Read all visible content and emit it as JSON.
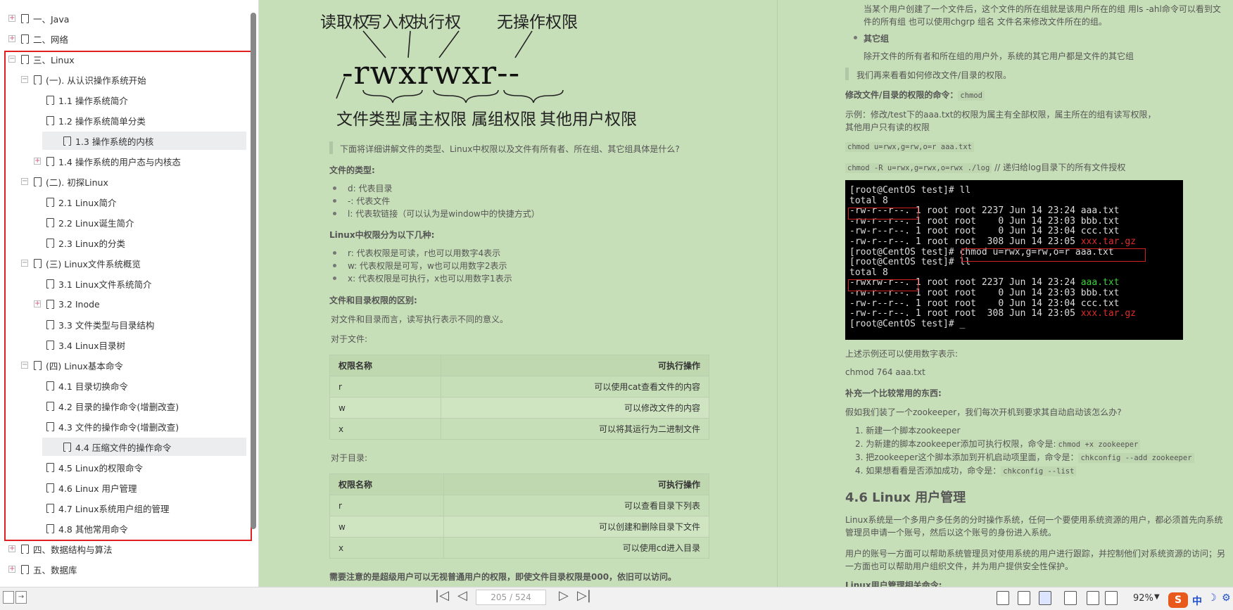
{
  "toc": [
    {
      "label": "一、Java",
      "level": 0,
      "expander": "plus"
    },
    {
      "label": "二、网络",
      "level": 0,
      "expander": "plus"
    },
    {
      "label": "三、Linux",
      "level": 0,
      "expander": "minus"
    },
    {
      "label": "(一). 从认识操作系统开始",
      "level": 1,
      "expander": "minus"
    },
    {
      "label": "1.1 操作系统简介",
      "level": 2,
      "expander": ""
    },
    {
      "label": "1.2 操作系统简单分类",
      "level": 2,
      "expander": ""
    },
    {
      "label": "1.3 操作系统的内核",
      "level": 2,
      "expander": "",
      "selected": true
    },
    {
      "label": "1.4 操作系统的用户态与内核态",
      "level": 2,
      "expander": "plus"
    },
    {
      "label": "(二). 初探Linux",
      "level": 1,
      "expander": "minus"
    },
    {
      "label": "2.1 Linux简介",
      "level": 2,
      "expander": ""
    },
    {
      "label": "2.2 Linux诞生简介",
      "level": 2,
      "expander": ""
    },
    {
      "label": "2.3 Linux的分类",
      "level": 2,
      "expander": ""
    },
    {
      "label": "(三) Linux文件系统概览",
      "level": 1,
      "expander": "minus"
    },
    {
      "label": "3.1 Linux文件系统简介",
      "level": 2,
      "expander": ""
    },
    {
      "label": "3.2 Inode",
      "level": 2,
      "expander": "plus"
    },
    {
      "label": "3.3 文件类型与目录结构",
      "level": 2,
      "expander": ""
    },
    {
      "label": "3.4 Linux目录树",
      "level": 2,
      "expander": ""
    },
    {
      "label": "(四) Linux基本命令",
      "level": 1,
      "expander": "minus"
    },
    {
      "label": "4.1 目录切换命令",
      "level": 2,
      "expander": ""
    },
    {
      "label": "4.2 目录的操作命令(增删改查)",
      "level": 2,
      "expander": ""
    },
    {
      "label": "4.3 文件的操作命令(增删改查)",
      "level": 2,
      "expander": ""
    },
    {
      "label": "4.4 压缩文件的操作命令",
      "level": 2,
      "expander": "",
      "selected": true
    },
    {
      "label": "4.5 Linux的权限命令",
      "level": 2,
      "expander": ""
    },
    {
      "label": "4.6 Linux 用户管理",
      "level": 2,
      "expander": ""
    },
    {
      "label": "4.7 Linux系统用户组的管理",
      "level": 2,
      "expander": ""
    },
    {
      "label": "4.8 其他常用命令",
      "level": 2,
      "expander": ""
    },
    {
      "label": "四、数据结构与算法",
      "level": 0,
      "expander": "plus"
    },
    {
      "label": "五、数据库",
      "level": 0,
      "expander": "plus"
    }
  ],
  "diagram": {
    "top": [
      "读取权",
      "写入权",
      "执行权",
      "无操作权限"
    ],
    "perm": "-rwxrwxr--",
    "bottom": [
      "文件类型",
      "属主权限",
      "属组权限",
      "其他用户权限"
    ]
  },
  "col1": {
    "intro": "下面将详细讲解文件的类型、Linux中权限以及文件有所有者、所在组、其它组具体是什么?",
    "types_h": "文件的类型:",
    "types": [
      "d: 代表目录",
      "-: 代表文件",
      "l: 代表软链接（可以认为是window中的快捷方式）"
    ],
    "perms_h": "Linux中权限分为以下几种:",
    "perms": [
      "r: 代表权限是可读，r也可以用数字4表示",
      "w: 代表权限是可写，w也可以用数字2表示",
      "x: 代表权限是可执行，x也可以用数字1表示"
    ],
    "diff_h": "文件和目录权限的区别:",
    "diff_p": "对文件和目录而言，读写执行表示不同的意义。",
    "file_p": "对于文件:",
    "table_file": {
      "head": [
        "权限名称",
        "可执行操作"
      ],
      "rows": [
        [
          "r",
          "可以使用cat查看文件的内容"
        ],
        [
          "w",
          "可以修改文件的内容"
        ],
        [
          "x",
          "可以将其运行为二进制文件"
        ]
      ]
    },
    "dir_p": "对于目录:",
    "table_dir": {
      "head": [
        "权限名称",
        "可执行操作"
      ],
      "rows": [
        [
          "r",
          "可以查看目录下列表"
        ],
        [
          "w",
          "可以创建和删除目录下文件"
        ],
        [
          "x",
          "可以使用cd进入目录"
        ]
      ]
    },
    "note": "需要注意的是超级用户可以无视普通用户的权限，即使文件目录权限是000，依旧可以访问。"
  },
  "col2": {
    "p1a": "当某个用户创建了一个文件后，这个文件的所在组就是该用户所在的组 用ls -ahl命令可以看到文",
    "p1b": "件的所有组 也可以使用chgrp  组名  文件名来修改文件所在的组。",
    "other_h": "其它组",
    "other_p": "除开文件的所有者和所在组的用户外，系统的其它用户都是文件的其它组",
    "bq": "我们再来看看如何修改文件/目录的权限。",
    "cmd_label": "修改文件/目录的权限的命令：",
    "cmd": "chmod",
    "ex1": "示例：修改/test下的aaa.txt的权限为属主有全部权限，属主所在的组有读写权限，",
    "ex2": "其他用户只有读的权限",
    "code1": "chmod u=rwx,g=rw,o=r aaa.txt",
    "code2": "chmod -R u=rwx,g=rwx,o=rwx ./log",
    "code2_note": "// 递归给log目录下的所有文件授权",
    "term": [
      {
        "parts": [
          {
            "t": "[root@CentOS test]# ll",
            "c": ""
          }
        ]
      },
      {
        "parts": [
          {
            "t": "total 8",
            "c": ""
          }
        ]
      },
      {
        "parts": [
          {
            "t": "-rw-r--r--. 1 root root 2237 Jun 14 23:24 aaa.txt",
            "c": ""
          }
        ]
      },
      {
        "parts": [
          {
            "t": "-rw-r--r--. 1 root root    0 Jun 14 23:03 bbb.txt",
            "c": ""
          }
        ]
      },
      {
        "parts": [
          {
            "t": "-rw-r--r--. 1 root root    0 Jun 14 23:04 ccc.txt",
            "c": ""
          }
        ]
      },
      {
        "parts": [
          {
            "t": "-rw-r--r--. 1 root root  308 Jun 14 23:05 ",
            "c": ""
          },
          {
            "t": "xxx.tar.gz",
            "c": "rd"
          }
        ]
      },
      {
        "parts": [
          {
            "t": "[root@CentOS test]# chmod u=rwx,g=rw,o=r aaa.txt",
            "c": ""
          }
        ]
      },
      {
        "parts": [
          {
            "t": "[root@CentOS test]# ll",
            "c": ""
          }
        ]
      },
      {
        "parts": [
          {
            "t": "total 8",
            "c": ""
          }
        ]
      },
      {
        "parts": [
          {
            "t": "-rwxrw-r--. 1 root root 2237 Jun 14 23:24 ",
            "c": ""
          },
          {
            "t": "aaa.txt",
            "c": "g"
          }
        ]
      },
      {
        "parts": [
          {
            "t": "-rw-r--r--. 1 root root    0 Jun 14 23:03 bbb.txt",
            "c": ""
          }
        ]
      },
      {
        "parts": [
          {
            "t": "-rw-r--r--. 1 root root    0 Jun 14 23:04 ccc.txt",
            "c": ""
          }
        ]
      },
      {
        "parts": [
          {
            "t": "-rw-r--r--. 1 root root  308 Jun 14 23:05 ",
            "c": ""
          },
          {
            "t": "xxx.tar.gz",
            "c": "rd"
          }
        ]
      },
      {
        "parts": [
          {
            "t": "[root@CentOS test]# _",
            "c": ""
          }
        ]
      }
    ],
    "num_p": "上述示例还可以使用数字表示:",
    "num_cmd": "chmod 764 aaa.txt",
    "extra_h": "补充一个比较常用的东西:",
    "extra_p": "假如我们装了一个zookeeper，我们每次开机到要求其自动启动该怎么办?",
    "steps": [
      {
        "text": "新建一个脚本zookeeper",
        "code": ""
      },
      {
        "text": "为新建的脚本zookeeper添加可执行权限，命令是:",
        "code": "chmod +x zookeeper"
      },
      {
        "text": "把zookeeper这个脚本添加到开机启动项里面，命令是：",
        "code": "chkconfig --add  zookeeper"
      },
      {
        "text": "如果想看看是否添加成功，命令是：",
        "code": "chkconfig --list"
      }
    ],
    "h46": "4.6 Linux 用户管理",
    "u1a": "Linux系统是一个多用户多任务的分时操作系统，任何一个要使用系统资源的用户，都必须首先向系统",
    "u1b": "管理员申请一个账号，然后以这个账号的身份进入系统。",
    "u2a": "用户的账号一方面可以帮助系统管理员对使用系统的用户进行跟踪，并控制他们对系统资源的访问；另",
    "u2b": "一方面也可以帮助用户组织文件，并为用户提供安全性保护。",
    "u3": "Linux用户管理相关命令:"
  },
  "bottombar": {
    "page": "205 / 524",
    "zoom": "92%",
    "ime": "中"
  }
}
